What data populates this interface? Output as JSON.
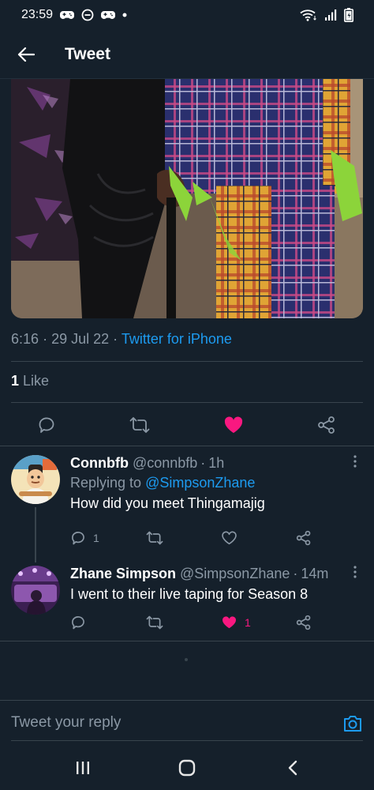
{
  "status_bar": {
    "time": "23:59",
    "icons_left": [
      "gamepad-icon",
      "do-not-disturb-icon",
      "gamepad-icon",
      "notification-dot-icon"
    ],
    "icons_right": [
      "wifi-icon",
      "signal-icon",
      "battery-icon"
    ]
  },
  "header": {
    "title": "Tweet"
  },
  "tweet": {
    "time": "6:16",
    "date": "29 Jul 22",
    "source": "Twitter for iPhone",
    "likes_count": "1",
    "likes_label": "Like",
    "liked": true
  },
  "colors": {
    "background": "#15202b",
    "accent": "#1d9bf0",
    "like": "#f91880",
    "secondary_text": "#8b98a5",
    "divider": "#38444d"
  },
  "replies": [
    {
      "name": "Connbfb",
      "handle": "@connbfb",
      "time": "1h",
      "replying_prefix": "Replying to",
      "replying_to": "@SimpsonZhane",
      "text": "How did you meet Thingamajig",
      "reply_count": "1",
      "retweet_count": "",
      "like_count": "",
      "liked": false
    },
    {
      "name": "Zhane Simpson",
      "handle": "@SimpsonZhane",
      "time": "14m",
      "text": "I went to their live taping for Season 8",
      "reply_count": "",
      "retweet_count": "",
      "like_count": "1",
      "liked": true
    }
  ],
  "composer": {
    "placeholder": "Tweet your reply"
  },
  "nav_bar": {
    "buttons": [
      "recent-apps-icon",
      "home-icon",
      "back-icon"
    ]
  }
}
